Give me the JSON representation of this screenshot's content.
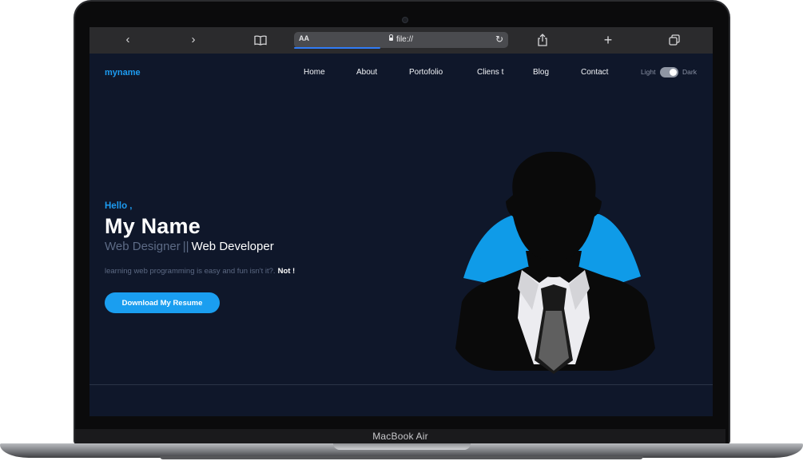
{
  "device": {
    "label": "MacBook Air"
  },
  "browser": {
    "url": "file://",
    "text_size_label": "AA",
    "buttons": {
      "back": "‹",
      "forward": "›",
      "bookmarks": "📖",
      "share": "⇪",
      "new_tab": "+",
      "tabs": "⧉",
      "reload": "↻"
    }
  },
  "site": {
    "logo": "myname",
    "nav": [
      "Home",
      "About",
      "Portofolio",
      "Cliens t",
      "Blog",
      "Contact"
    ],
    "theme": {
      "light_label": "Light",
      "dark_label": "Dark",
      "mode": "dark"
    },
    "hero": {
      "greeting": "Hello ,",
      "name": "My Name",
      "role_primary": "Web Designer",
      "role_separator": "||",
      "role_secondary": "Web Developer",
      "tagline": "learning web programming is easy and fun isn't it?.",
      "tagline_emphasis": "Not !",
      "cta_label": "Download My Resume"
    },
    "icons": {
      "avatar": "person-silhouette-icon"
    },
    "colors": {
      "accent": "#1d9bf0",
      "background": "#0f172a",
      "muted_text": "#5d6b86"
    }
  }
}
